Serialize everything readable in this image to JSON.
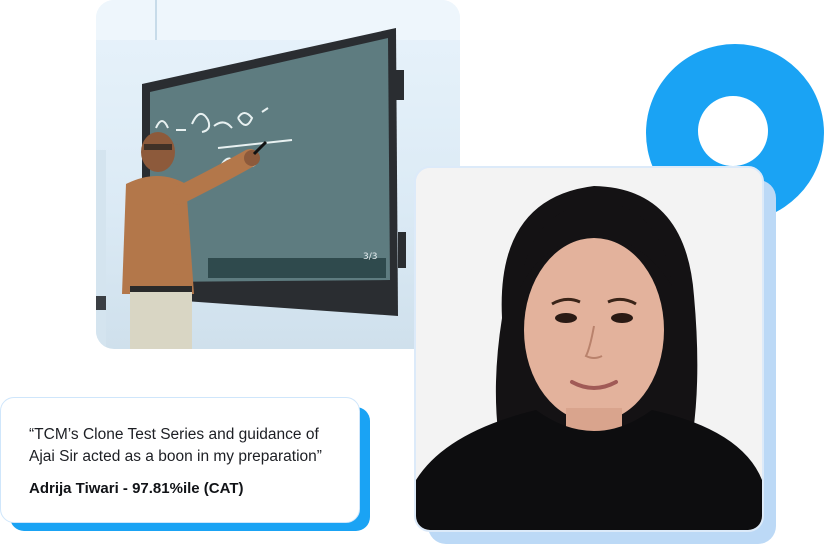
{
  "testimonial": {
    "quote": "“TCM’s Clone Test Series and guidance of Ajai Sir acted as a boon in my preparation”",
    "author": "Adrija Tiwari - 97.81%ile (CAT)"
  },
  "classroom_photo": {
    "board_page_indicator": "3/3"
  },
  "colors": {
    "accent": "#1aa3f4",
    "accent_light": "#bcd9f6",
    "card_border": "#cfe6fb"
  }
}
